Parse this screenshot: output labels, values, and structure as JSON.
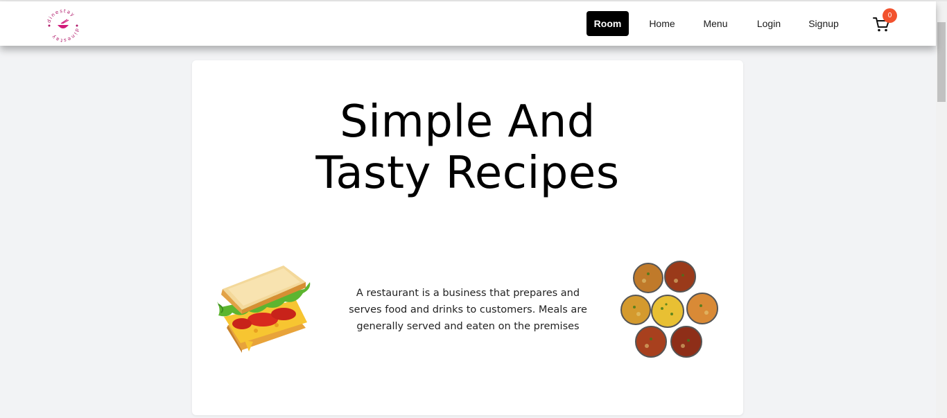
{
  "brand": {
    "logo_text": "dinestay",
    "icon": "bowl-chopsticks-icon"
  },
  "nav": {
    "items": [
      {
        "label": "Room",
        "active": true
      },
      {
        "label": "Home",
        "active": false
      },
      {
        "label": "Menu",
        "active": false
      },
      {
        "label": "Login",
        "active": false
      },
      {
        "label": "Signup",
        "active": false
      }
    ],
    "cart_icon": "cart-icon",
    "cart_count": "0"
  },
  "hero": {
    "title_line1": "Simple And",
    "title_line2": "Tasty Recipes",
    "description": "A restaurant is a business that prepares and serves food and drinks to customers. Meals are generally served and eaten on the premises",
    "left_image": "sandwich-image",
    "right_image": "curry-bowls-image"
  },
  "colors": {
    "accent_badge": "#f2522e",
    "active_nav_bg": "#000000",
    "logo_pink": "#d11a7a",
    "page_bg": "#f2f3f5"
  }
}
